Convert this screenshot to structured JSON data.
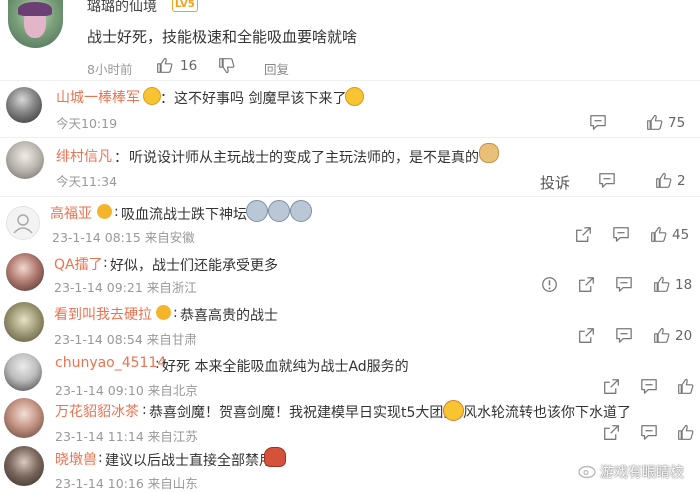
{
  "top_post": {
    "username": "璐璐的仙境",
    "level": "LV5",
    "text": "战士好死，技能极速和全能吸血要啥就啥",
    "time": "8小时前",
    "likes": "16",
    "reply_label": "回复"
  },
  "comments": [
    {
      "name": "山城一棒棒军",
      "sep": "：",
      "text": "这不好事吗 剑魔早该下来了",
      "time": "今天10:19",
      "likes": "75"
    },
    {
      "name": "绯村信凡",
      "sep": "：",
      "text": "听说设计师从主玩战士的变成了主玩法师的，是不是真的",
      "time": "今天11:34",
      "report_label": "投诉",
      "likes": "2"
    },
    {
      "name": "高福亚",
      "sep": ":",
      "text": "吸血流战士跌下神坛",
      "time": "23-1-14 08:15 来自安徽",
      "likes": "45"
    },
    {
      "name": "QA擂了",
      "sep": ":",
      "text": "好似，战士们还能承受更多",
      "time": "23-1-14 09:21 来自浙江",
      "likes": "18"
    },
    {
      "name": "看到叫我去硬拉",
      "sep": ":",
      "text": "恭喜高贵的战士",
      "time": "23-1-14 08:54 来自甘肃",
      "likes": "20"
    },
    {
      "name": "chunyao_45114",
      "sep": ":",
      "text": "好死 本来全能吸血就纯为战士Ad服务的",
      "time": "23-1-14 09:10 来自北京",
      "likes": ""
    },
    {
      "name": "万花貂貂冰茶",
      "sep": ":",
      "text": "恭喜剑魔！贺喜剑魔！我祝建模早日实现t5大团圆",
      "text2": "风水轮流转也该你下水道了",
      "time": "23-1-14 11:14 来自江苏",
      "likes": ""
    },
    {
      "name": "晓墩兽",
      "sep": ":",
      "text": "建议以后战士直接全部禁用",
      "time": "23-1-14 10:16 来自山东",
      "likes": ""
    }
  ],
  "watermark": "游戏有眼睛校",
  "colors": {
    "name": "#eb7350",
    "meta": "#999999",
    "text": "#333333",
    "badge": "#f0a41e"
  }
}
